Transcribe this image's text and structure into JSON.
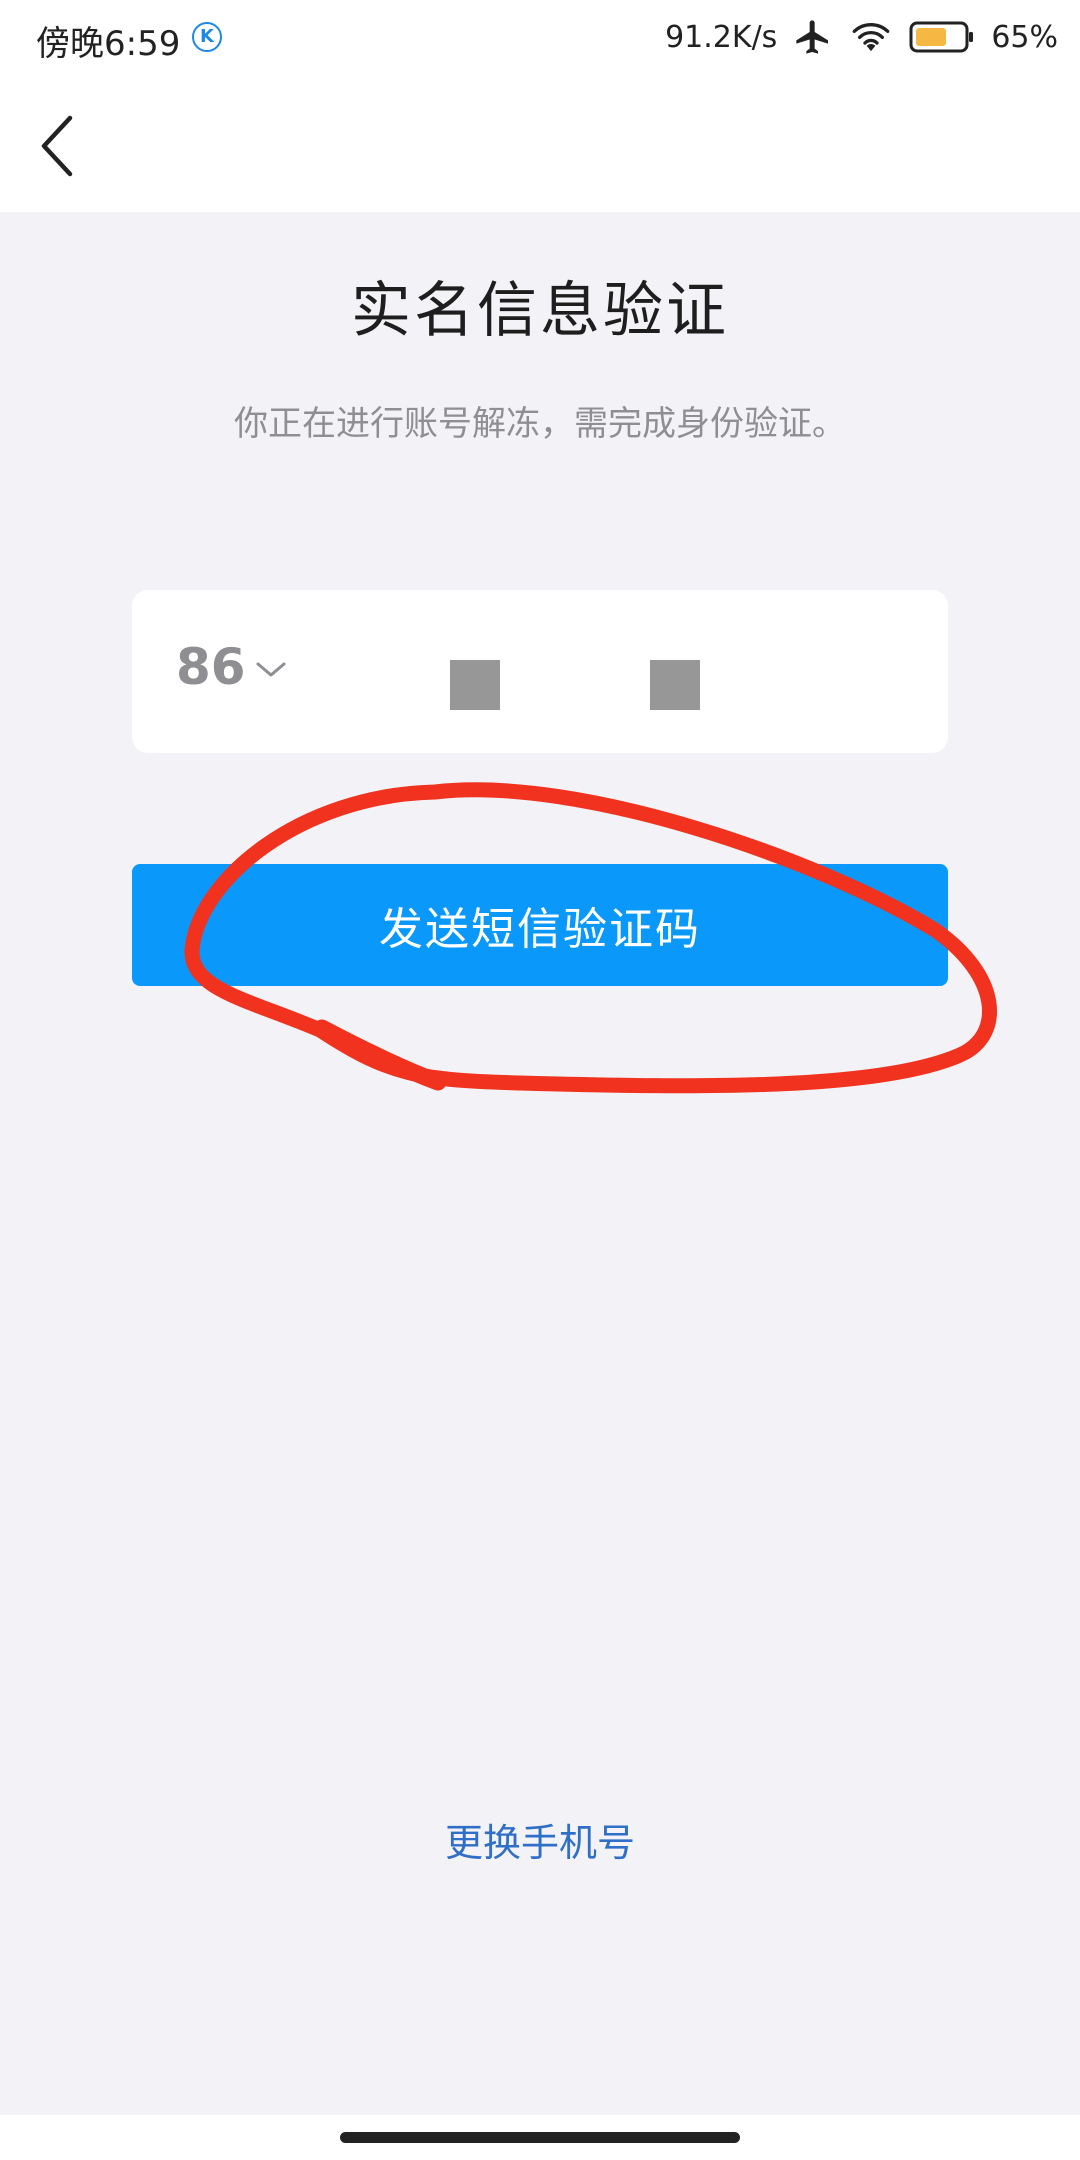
{
  "status_bar": {
    "time": "傍晚6:59",
    "app_badge_letter": "K",
    "network_speed": "91.2K/s",
    "battery_percent": "65%",
    "battery_level": 0.65,
    "icons": [
      "airplane-icon",
      "wifi-icon",
      "battery-icon"
    ]
  },
  "nav": {
    "back_icon": "chevron-left-icon"
  },
  "page": {
    "title": "实名信息验证",
    "subtitle": "你正在进行账号解冻，需完成身份验证。"
  },
  "phone_input": {
    "country_code": "86",
    "dropdown_icon": "chevron-down-icon",
    "masked_digits": 2
  },
  "send_button": {
    "label": "发送短信验证码"
  },
  "change_phone": {
    "label": "更换手机号"
  },
  "colors": {
    "primary_button": "#0a99fa",
    "link": "#2f6fc8",
    "annotation": "#f0321e",
    "background": "#f2f2f7",
    "battery_fill": "#f5b842"
  }
}
